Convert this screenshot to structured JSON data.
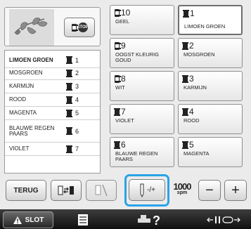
{
  "preview": {
    "stop_label": "STOP"
  },
  "list": {
    "rows": [
      {
        "name": "LIMOEN GROEN",
        "num": "1",
        "selected": true
      },
      {
        "name": "MOSGROEN",
        "num": "2"
      },
      {
        "name": "KARMIJN",
        "num": "3"
      },
      {
        "name": "ROOD",
        "num": "4"
      },
      {
        "name": "MAGENTA",
        "num": "5"
      },
      {
        "name": "BLAUWE REGEN PAARS",
        "num": "6"
      },
      {
        "name": "VIOLET",
        "num": "7"
      }
    ]
  },
  "threads": [
    {
      "num": "10",
      "label": "GEEL",
      "hollow": true
    },
    {
      "num": "1",
      "label": "LIMOEN GROEN",
      "hollow": false
    },
    {
      "num": "9",
      "label": "OOGST KLEURIG GOUD",
      "hollow": true
    },
    {
      "num": "2",
      "label": "MOSGROEN",
      "hollow": false
    },
    {
      "num": "8",
      "label": "WIT",
      "hollow": true
    },
    {
      "num": "3",
      "label": "KARMIJN",
      "hollow": false
    },
    {
      "num": "7",
      "label": "VIOLET",
      "hollow": false
    },
    {
      "num": "4",
      "label": "ROOD",
      "hollow": false
    },
    {
      "num": "6",
      "label": "BLAUWE REGEN PAARS",
      "hollow": false
    },
    {
      "num": "5",
      "label": "MAGENTA",
      "hollow": false
    }
  ],
  "toolbar": {
    "terug_label": "TERUG",
    "needle_label": "-/+",
    "speed_value": "1000",
    "speed_unit": "spm",
    "minus_label": "−",
    "plus_label": "+"
  },
  "bottom": {
    "slot_label": "SLOT"
  },
  "colors": {
    "highlight": "#29a3e8",
    "bar": "#1a1a1a"
  }
}
